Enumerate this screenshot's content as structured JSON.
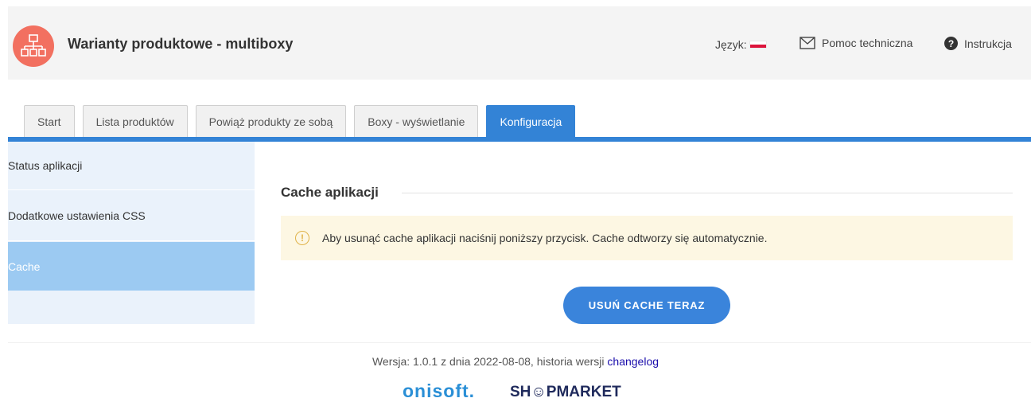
{
  "header": {
    "title": "Warianty produktowe - multiboxy",
    "logo_icon": "sitemap-icon",
    "language_label": "Język:",
    "support_label": "Pomoc techniczna",
    "support_icon": "envelope-icon",
    "manual_label": "Instrukcja",
    "manual_icon": "help-circle-icon"
  },
  "tabs": [
    {
      "label": "Start",
      "active": false
    },
    {
      "label": "Lista produktów",
      "active": false
    },
    {
      "label": "Powiąż produkty ze sobą",
      "active": false
    },
    {
      "label": "Boxy - wyświetlanie",
      "active": false
    },
    {
      "label": "Konfiguracja",
      "active": true
    }
  ],
  "sidebar": {
    "items": [
      {
        "label": "Status aplikacji",
        "active": false
      },
      {
        "label": "Dodatkowe ustawienia CSS",
        "active": false
      },
      {
        "label": "Cache",
        "active": true
      }
    ]
  },
  "main": {
    "section_title": "Cache aplikacji",
    "alert_text": "Aby usunąć cache aplikacji naciśnij poniższy przycisk. Cache odtworzy się automatycznie.",
    "clear_button": "USUŃ CACHE TERAZ"
  },
  "footer": {
    "version_text": "Wersja: 1.0.1 z dnia 2022-08-08, historia wersji ",
    "changelog_link": "changelog",
    "logo_left": "onisoft.",
    "logo_right": "SH☺PMARKET"
  },
  "colors": {
    "accent": "#3383d6",
    "logo_bg": "#f27060",
    "sidebar_active": "#9ccaf2",
    "alert_bg": "#fdf7e3"
  }
}
